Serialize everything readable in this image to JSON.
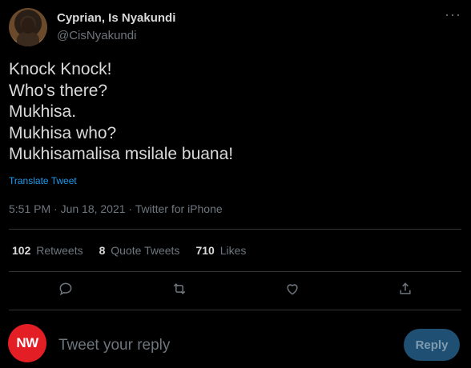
{
  "author": {
    "display_name": "Cyprian, Is Nyakundi",
    "handle": "@CisNyakundi"
  },
  "more_label": "···",
  "tweet": {
    "text": "Knock Knock!\nWho's there?\nMukhisa.\nMukhisa who?\nMukhisamalisa msilale buana!",
    "translate_label": "Translate Tweet",
    "timestamp": "5:51 PM · Jun 18, 2021 · Twitter for iPhone"
  },
  "stats": {
    "retweets": {
      "count": "102",
      "label": "Retweets"
    },
    "quote_tweets": {
      "count": "8",
      "label": "Quote Tweets"
    },
    "likes": {
      "count": "710",
      "label": "Likes"
    }
  },
  "actions": [
    "reply-icon",
    "retweet-icon",
    "like-icon",
    "share-icon"
  ],
  "composer": {
    "avatar_text": "NW",
    "placeholder": "Tweet your reply",
    "reply_button": "Reply"
  },
  "colors": {
    "background": "#000000",
    "text": "#d9d9d9",
    "muted": "#6e767d",
    "link": "#1d9bf0",
    "reply_button_bg": "#1f4f72",
    "avatar_red": "#e31e24"
  }
}
